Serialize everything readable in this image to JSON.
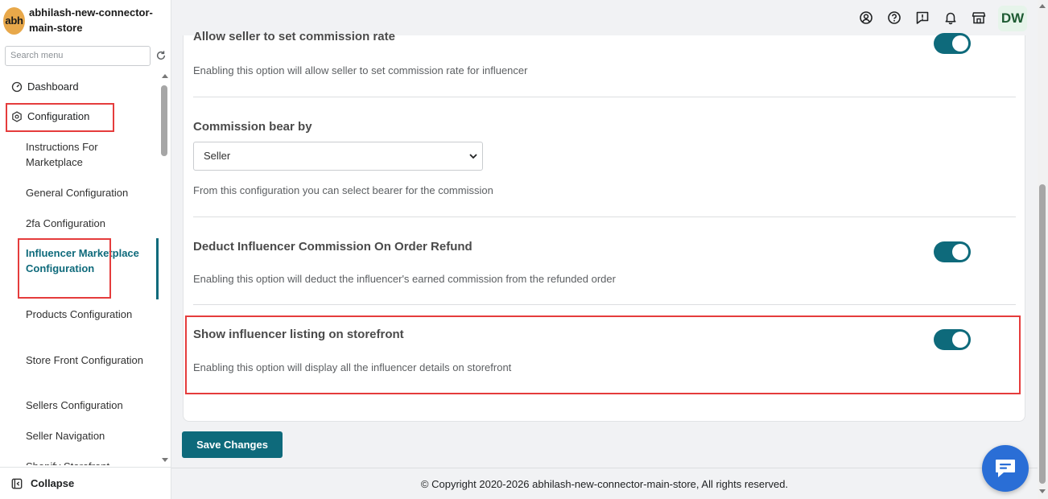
{
  "store": {
    "avatar_text": "abh",
    "name": "abhilash-new-connector-main-store"
  },
  "search": {
    "placeholder": "Search menu"
  },
  "menu": {
    "dashboard": "Dashboard",
    "configuration": "Configuration",
    "items": [
      "Instructions For Marketplace",
      "General Configuration",
      "2fa Configuration",
      "Influencer Marketplace Configuration",
      "Products Configuration",
      "Store Front Configuration",
      "Sellers Configuration",
      "Seller Navigation",
      "Shopify Storefront"
    ],
    "active_item": "Influencer Marketplace Configuration"
  },
  "collapse_label": "Collapse",
  "topbar": {
    "icons": [
      "user-circle-icon",
      "help-icon",
      "feedback-icon",
      "bell-icon",
      "store-icon"
    ],
    "avatar": "DW"
  },
  "settings": {
    "seller_commission": {
      "title": "Allow seller to set commission rate",
      "description": "Enabling this option will allow seller to set commission rate for influencer",
      "enabled": true
    },
    "commission_bear": {
      "title": "Commission bear by",
      "selected": "Seller",
      "description": "From this configuration you can select bearer for the commission"
    },
    "deduct_refund": {
      "title": "Deduct Influencer Commission On Order Refund",
      "description": "Enabling this option will deduct the influencer's earned commission from the refunded order",
      "enabled": true
    },
    "show_listing": {
      "title": "Show influencer listing on storefront",
      "description": "Enabling this option will display all the influencer details on storefront",
      "enabled": true
    }
  },
  "save_label": "Save Changes",
  "footer": "© Copyright 2020-2026 abhilash-new-connector-main-store, All rights reserved.",
  "colors": {
    "accent": "#0e6a7b",
    "highlight_border": "#e53c3c",
    "chat": "#2a6ed6"
  }
}
